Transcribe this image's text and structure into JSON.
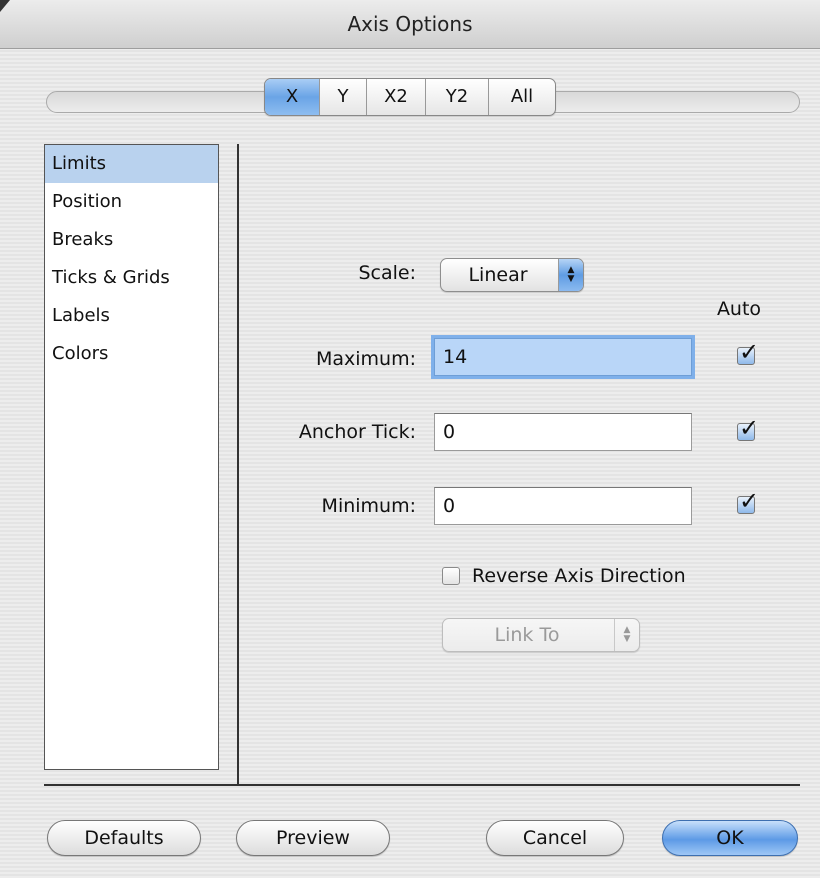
{
  "window": {
    "title": "Axis Options"
  },
  "tabs": [
    {
      "label": "X",
      "selected": true
    },
    {
      "label": "Y",
      "selected": false
    },
    {
      "label": "X2",
      "selected": false
    },
    {
      "label": "Y2",
      "selected": false
    },
    {
      "label": "All",
      "selected": false
    }
  ],
  "categories": [
    {
      "label": "Limits",
      "selected": true
    },
    {
      "label": "Position",
      "selected": false
    },
    {
      "label": "Breaks",
      "selected": false
    },
    {
      "label": "Ticks & Grids",
      "selected": false
    },
    {
      "label": "Labels",
      "selected": false
    },
    {
      "label": "Colors",
      "selected": false
    }
  ],
  "limits": {
    "scale_label": "Scale:",
    "scale_value": "Linear",
    "auto_label": "Auto",
    "maximum_label": "Maximum:",
    "maximum_value": "14",
    "maximum_auto": true,
    "anchor_label": "Anchor Tick:",
    "anchor_value": "0",
    "anchor_auto": true,
    "minimum_label": "Minimum:",
    "minimum_value": "0",
    "minimum_auto": true,
    "reverse_label": "Reverse Axis Direction",
    "reverse_checked": false,
    "link_to_label": "Link To"
  },
  "buttons": {
    "defaults": "Defaults",
    "preview": "Preview",
    "cancel": "Cancel",
    "ok": "OK"
  },
  "icons": {
    "checkmark": "checkmark-icon",
    "stepper": "up-down-arrows-icon"
  },
  "colors": {
    "selection": "#b9d2ee",
    "accent": "#5d9ae6"
  }
}
